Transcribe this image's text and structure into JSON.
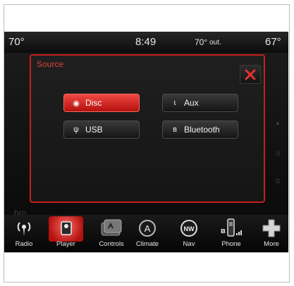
{
  "status_bar": {
    "temp_left": "70°",
    "time": "8:49",
    "temp_out": "70°",
    "temp_out_suffix": "out.",
    "temp_right": "67°"
  },
  "background_label": "bro",
  "source_popup": {
    "title": "Source",
    "buttons": [
      {
        "label": "Disc",
        "icon": "disc-icon",
        "selected": true
      },
      {
        "label": "Aux",
        "icon": "aux-icon",
        "selected": false
      },
      {
        "label": "USB",
        "icon": "usb-icon",
        "selected": false
      },
      {
        "label": "Bluetooth",
        "icon": "bluetooth-icon",
        "selected": false
      }
    ],
    "close_icon": "close-icon"
  },
  "nav": [
    {
      "label": "Radio",
      "icon": "radio-icon"
    },
    {
      "label": "Player",
      "icon": "player-icon",
      "active": true
    },
    {
      "label": "Controls",
      "icon": "controls-icon"
    },
    {
      "label": "Climate",
      "icon": "climate-icon"
    },
    {
      "label": "Nav",
      "icon": "nav-icon"
    },
    {
      "label": "Phone",
      "icon": "phone-icon"
    },
    {
      "label": "More",
      "icon": "more-icon"
    }
  ],
  "colors": {
    "accent_red": "#c3201d",
    "selected_button": "#e43a34",
    "background": "#121212"
  }
}
